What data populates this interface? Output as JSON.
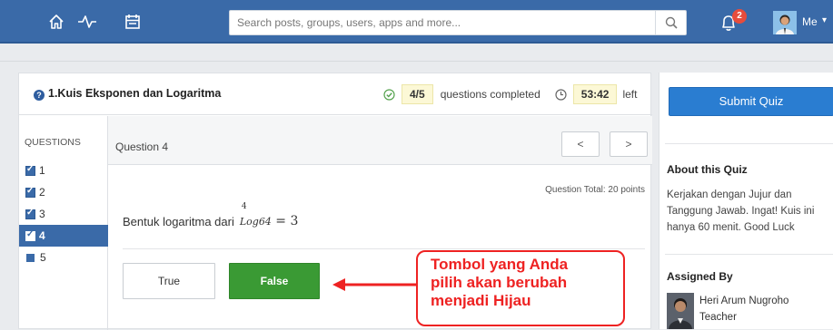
{
  "topbar": {
    "search_placeholder": "Search posts, groups, users, apps and more...",
    "notification_count": "2",
    "user_label": "Me",
    "bg_color": "#3a6aa8"
  },
  "quiz": {
    "title": "1.Kuis Eksponen dan Logaritma",
    "progress_value": "4/5",
    "progress_label": "questions completed",
    "timer_value": "53:42",
    "timer_label": "left"
  },
  "sidebar": {
    "heading": "QUESTIONS",
    "items": [
      {
        "label": "1",
        "state": "checked"
      },
      {
        "label": "2",
        "state": "checked"
      },
      {
        "label": "3",
        "state": "checked"
      },
      {
        "label": "4",
        "state": "active"
      },
      {
        "label": "5",
        "state": "unanswered"
      }
    ]
  },
  "question": {
    "label": "Question 4",
    "prev_label": "<",
    "next_label": ">",
    "total": "Question Total: 20 points",
    "text": "Bentuk logaritma dari",
    "math_sup": "4",
    "math_sub": "Log64",
    "math_rest": " = 3",
    "answers": {
      "true_label": "True",
      "false_label": "False",
      "selected_color": "#3a9a34"
    }
  },
  "annotation": {
    "lines": [
      "Tombol yang Anda",
      "pilih akan berubah",
      "menjadi Hijau"
    ],
    "color": "#e22222"
  },
  "right": {
    "submit_label": "Submit Quiz",
    "about_heading": "About this Quiz",
    "about_text": "Kerjakan dengan Jujur dan Tanggung Jawab. Ingat! Kuis ini hanya 60 menit. Good Luck",
    "assigned_heading": "Assigned By",
    "teacher_name": "Heri Arum Nugroho",
    "teacher_role": "Teacher"
  }
}
